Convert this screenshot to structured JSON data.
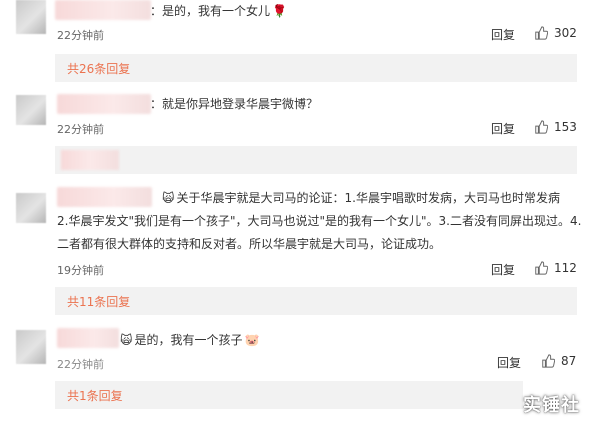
{
  "comments": [
    {
      "text": "：是的，我有一个女儿",
      "emoji": "🌹",
      "time": "22分钟前",
      "reply": "回复",
      "likes": "302",
      "sub": "共26条回复"
    },
    {
      "text": "：就是你异地登录华晨宇微博？",
      "time": "22分钟前",
      "reply": "回复",
      "likes": "153"
    },
    {
      "line1": "关于华晨宇就是大司马的论证：1.华晨宇唱歌时发病，大司马也时常发病",
      "line2": "2.华晨宇发文\"我们是有一个孩子\"，大司马也说过\"是的我有一个女儿\"。3.二者没有同屏出现过。4.",
      "line3": "二者都有很大群体的支持和反对者。所以华晨宇就是大司马，论证成功。",
      "emoji": "🙀",
      "time": "19分钟前",
      "reply": "回复",
      "likes": "112",
      "sub": "共11条回复"
    },
    {
      "text": "是的，我有一个孩子",
      "emoji_pre": "🙀",
      "emoji": "🐷",
      "time": "22分钟前",
      "reply": "回复",
      "likes": "87",
      "sub": "共1条回复"
    }
  ],
  "watermark": "实锤社"
}
